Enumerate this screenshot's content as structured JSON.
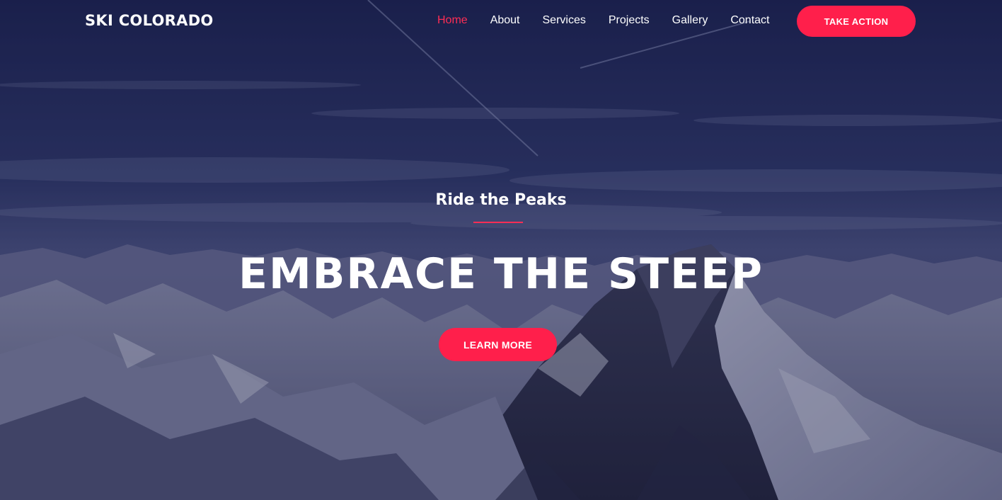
{
  "brand": {
    "name": "SKI COLORADO"
  },
  "nav": {
    "items": [
      {
        "label": "Home",
        "active": true
      },
      {
        "label": "About",
        "active": false
      },
      {
        "label": "Services",
        "active": false
      },
      {
        "label": "Projects",
        "active": false
      },
      {
        "label": "Gallery",
        "active": false
      },
      {
        "label": "Contact",
        "active": false
      }
    ],
    "cta_label": "TAKE ACTION"
  },
  "hero": {
    "subtitle": "Ride the Peaks",
    "headline": "EMBRACE THE STEEP",
    "button_label": "LEARN MORE",
    "background": "snowy-mountain-range-photo"
  },
  "colors": {
    "accent": "#ff1f4b",
    "active_link": "#ff2d55",
    "text": "#ffffff",
    "sky_dark": "#1c2450"
  }
}
